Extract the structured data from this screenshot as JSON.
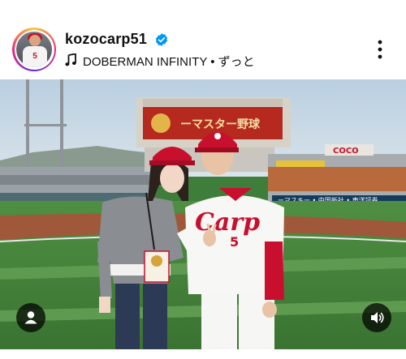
{
  "post_header": {
    "username": "kozocarp51",
    "verified": true,
    "song_line": "DOBERMAN INFINITY • ずっと",
    "avatar_jersey_number": "5"
  },
  "photo": {
    "scoreboard_text": "ーマスター野球",
    "jersey_wordmark": "Carp",
    "jersey_number": "5",
    "right_stand_sign": "COCO",
    "right_banner": "ーマスキー • 中国新社 • 東洋証券"
  },
  "icons": {
    "verified": "verified-badge-icon",
    "music": "music-note-icon",
    "more": "more-options-icon",
    "tag": "user-tag-icon",
    "sound": "volume-icon"
  },
  "colors": {
    "verified_blue": "#0095f6",
    "carp_red": "#c8102e"
  }
}
